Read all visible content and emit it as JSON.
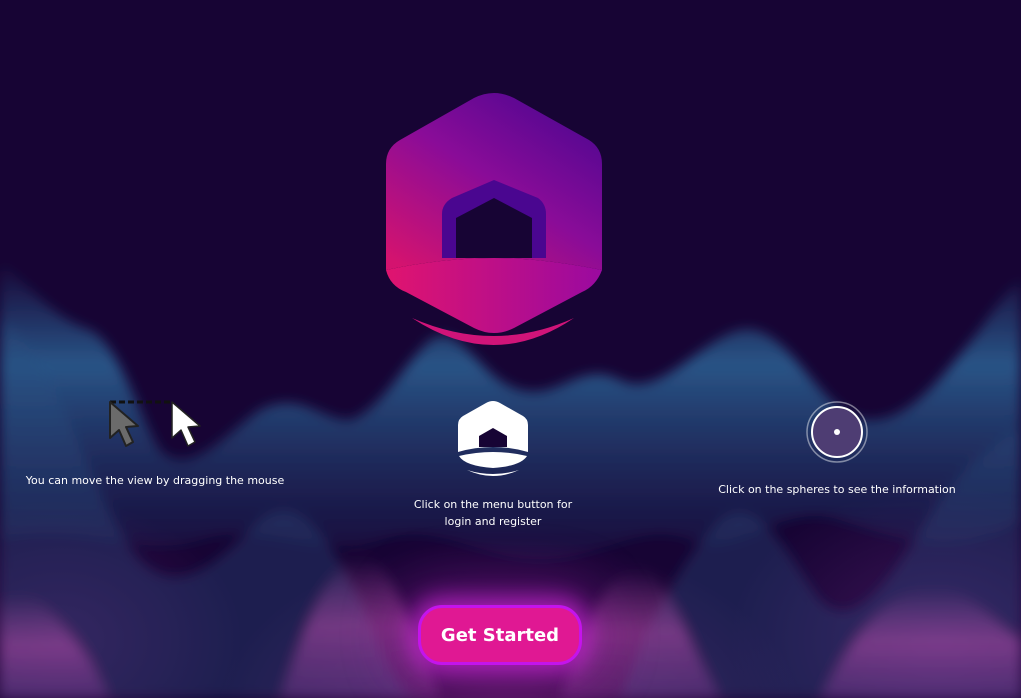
{
  "hints": {
    "drag": "You can move the view by dragging the mouse",
    "menu": "Click on the menu button for login and register",
    "sphere": "Click on the spheres to see the information"
  },
  "cta": {
    "label": "Get Started"
  },
  "icons": {
    "logo": "hexagon-house-logo-icon",
    "drag": "mouse-cursor-drag-icon",
    "menu": "house-menu-icon",
    "sphere": "sphere-hotspot-icon"
  },
  "colors": {
    "background": "#170434",
    "accent_pink": "#e01893",
    "accent_purple": "#5a0796",
    "button_border": "#c414ec",
    "wave_blue": "#2b5f8e"
  }
}
